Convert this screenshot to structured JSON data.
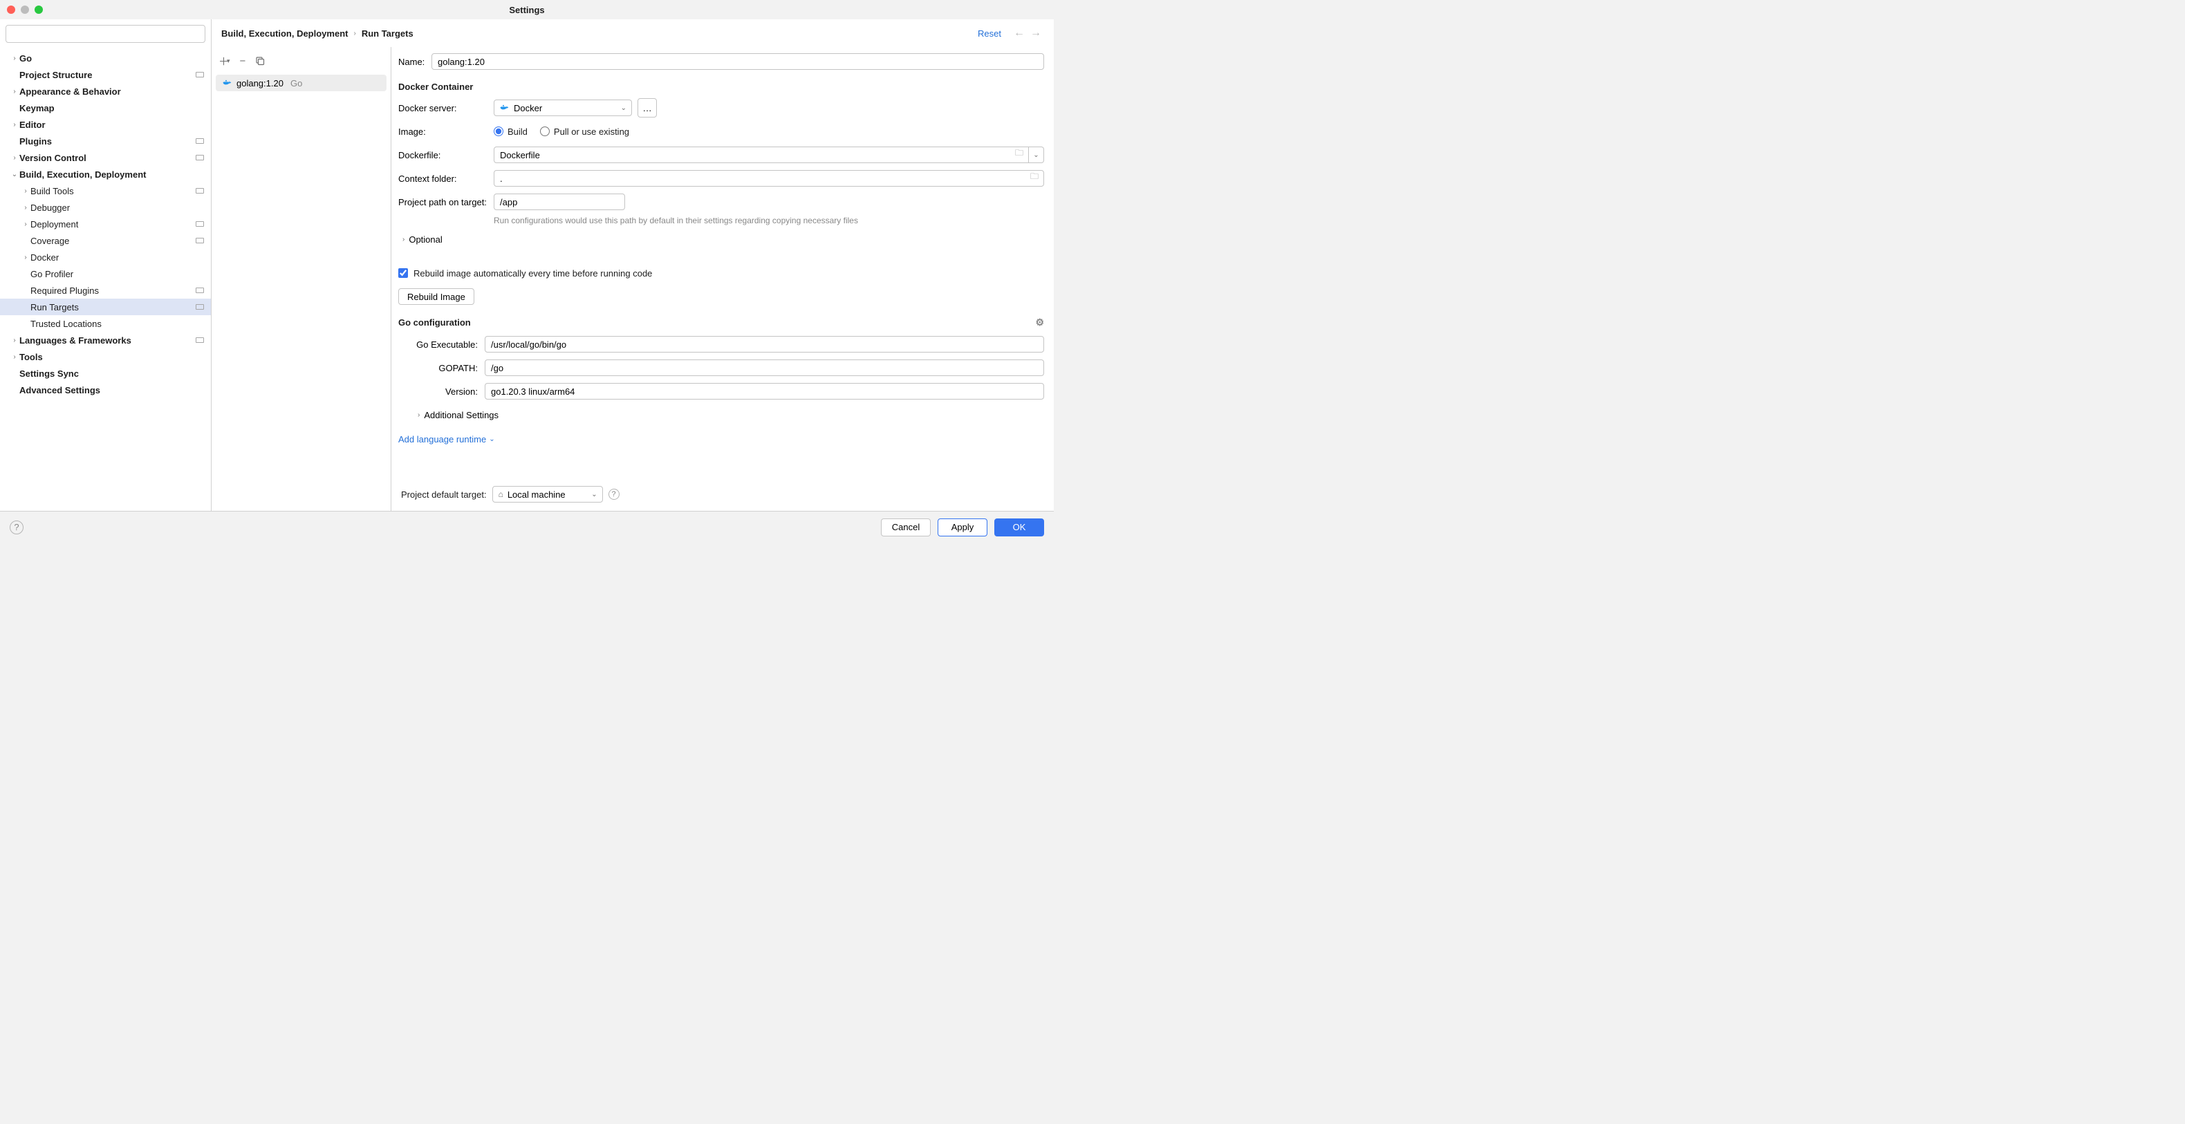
{
  "window": {
    "title": "Settings"
  },
  "search": {
    "placeholder": ""
  },
  "sidebar": {
    "items": [
      {
        "label": "Go",
        "bold": true,
        "chev": "right",
        "indent": 0,
        "badge": false
      },
      {
        "label": "Project Structure",
        "bold": true,
        "chev": "",
        "indent": 0,
        "badge": true
      },
      {
        "label": "Appearance & Behavior",
        "bold": true,
        "chev": "right",
        "indent": 0,
        "badge": false
      },
      {
        "label": "Keymap",
        "bold": true,
        "chev": "",
        "indent": 0,
        "badge": false
      },
      {
        "label": "Editor",
        "bold": true,
        "chev": "right",
        "indent": 0,
        "badge": false
      },
      {
        "label": "Plugins",
        "bold": true,
        "chev": "",
        "indent": 0,
        "badge": true
      },
      {
        "label": "Version Control",
        "bold": true,
        "chev": "right",
        "indent": 0,
        "badge": true
      },
      {
        "label": "Build, Execution, Deployment",
        "bold": true,
        "chev": "down",
        "indent": 0,
        "badge": false
      },
      {
        "label": "Build Tools",
        "bold": false,
        "chev": "right",
        "indent": 1,
        "badge": true
      },
      {
        "label": "Debugger",
        "bold": false,
        "chev": "right",
        "indent": 1,
        "badge": false
      },
      {
        "label": "Deployment",
        "bold": false,
        "chev": "right",
        "indent": 1,
        "badge": true
      },
      {
        "label": "Coverage",
        "bold": false,
        "chev": "",
        "indent": 1,
        "badge": true
      },
      {
        "label": "Docker",
        "bold": false,
        "chev": "right",
        "indent": 1,
        "badge": false
      },
      {
        "label": "Go Profiler",
        "bold": false,
        "chev": "",
        "indent": 1,
        "badge": false
      },
      {
        "label": "Required Plugins",
        "bold": false,
        "chev": "",
        "indent": 1,
        "badge": true
      },
      {
        "label": "Run Targets",
        "bold": false,
        "chev": "",
        "indent": 1,
        "badge": true,
        "selected": true
      },
      {
        "label": "Trusted Locations",
        "bold": false,
        "chev": "",
        "indent": 1,
        "badge": false
      },
      {
        "label": "Languages & Frameworks",
        "bold": true,
        "chev": "right",
        "indent": 0,
        "badge": true
      },
      {
        "label": "Tools",
        "bold": true,
        "chev": "right",
        "indent": 0,
        "badge": false
      },
      {
        "label": "Settings Sync",
        "bold": true,
        "chev": "",
        "indent": 0,
        "badge": false
      },
      {
        "label": "Advanced Settings",
        "bold": true,
        "chev": "",
        "indent": 0,
        "badge": false
      }
    ]
  },
  "targets": {
    "list": [
      {
        "name": "golang:1.20",
        "lang": "Go"
      }
    ]
  },
  "breadcrumb": {
    "items": [
      "Build, Execution, Deployment",
      "Run Targets"
    ],
    "reset": "Reset"
  },
  "form": {
    "name_label": "Name:",
    "name_value": "golang:1.20",
    "docker_section": "Docker Container",
    "docker_server_label": "Docker server:",
    "docker_server_value": "Docker",
    "image_label": "Image:",
    "image_build": "Build",
    "image_pull": "Pull or use existing",
    "dockerfile_label": "Dockerfile:",
    "dockerfile_value": "Dockerfile",
    "context_label": "Context folder:",
    "context_value": ".",
    "project_path_label": "Project path on target:",
    "project_path_value": "/app",
    "project_path_hint": "Run configurations would use this path by default in their settings regarding copying necessary files",
    "optional": "Optional",
    "rebuild_checkbox": "Rebuild image automatically every time before running code",
    "rebuild_button": "Rebuild Image",
    "go_section": "Go configuration",
    "go_exe_label": "Go Executable:",
    "go_exe_value": "/usr/local/go/bin/go",
    "gopath_label": "GOPATH:",
    "gopath_value": "/go",
    "version_label": "Version:",
    "version_value": "go1.20.3 linux/arm64",
    "additional": "Additional Settings",
    "add_runtime": "Add language runtime"
  },
  "default_target": {
    "label": "Project default target:",
    "value": "Local machine"
  },
  "footer": {
    "cancel": "Cancel",
    "apply": "Apply",
    "ok": "OK"
  }
}
